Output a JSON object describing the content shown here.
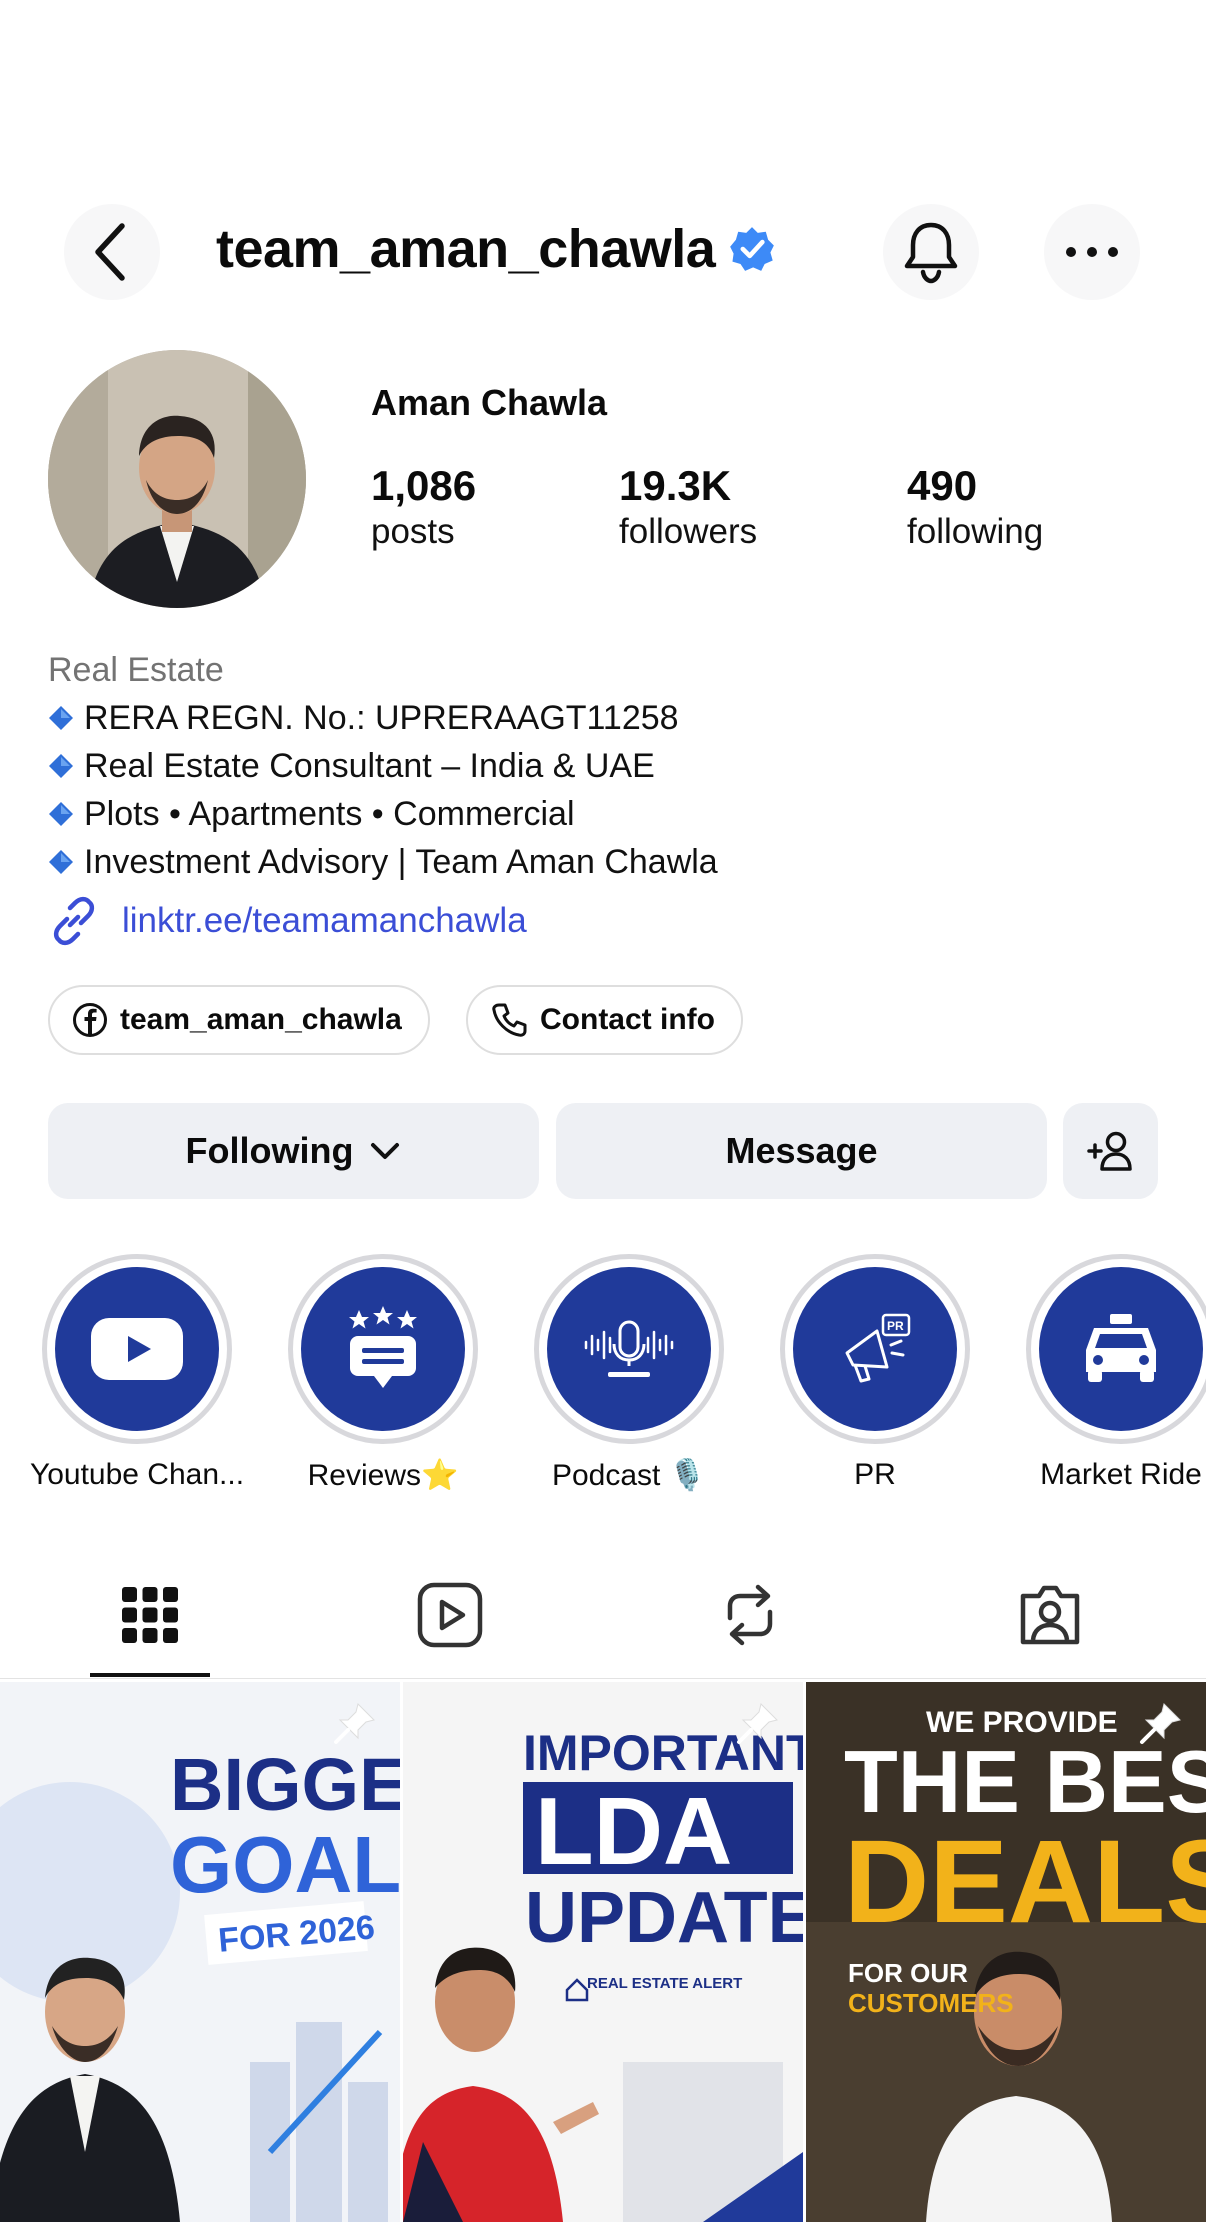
{
  "header": {
    "username": "team_aman_chawla",
    "back_icon": "chevron-left-icon",
    "bell_icon": "bell-icon",
    "more_icon": "more-horizontal-icon"
  },
  "profile": {
    "name": "Aman Chawla",
    "stats": [
      {
        "value": "1,086",
        "label": "posts"
      },
      {
        "value": "19.3K",
        "label": "followers"
      },
      {
        "value": "490",
        "label": "following"
      }
    ],
    "category": "Real Estate",
    "bio_lines": [
      "RERA REGN. No.: UPRERAAGT11258",
      "Real Estate Consultant – India & UAE",
      "Plots • Apartments • Commercial",
      "Investment Advisory | Team Aman Chawla"
    ],
    "link": "linktr.ee/teamamanchawla"
  },
  "chips": {
    "facebook": "team_aman_chawla",
    "contact": "Contact info"
  },
  "actions": {
    "following": "Following",
    "message": "Message"
  },
  "highlights": [
    {
      "label": "Youtube Chan...",
      "icon": "youtube-icon"
    },
    {
      "label": "Reviews⭐",
      "icon": "reviews-icon"
    },
    {
      "label": "Podcast 🎙️",
      "icon": "podcast-icon"
    },
    {
      "label": "PR",
      "icon": "megaphone-icon"
    },
    {
      "label": "Market Ride",
      "icon": "car-icon"
    }
  ],
  "posts": [
    {
      "line1": "BIGGER",
      "line2": "GOALS",
      "line3": "FOR 2026"
    },
    {
      "line1": "IMPORTANT",
      "line2": "LDA",
      "line3": "UPDATE",
      "tag": "REAL ESTATE ALERT"
    },
    {
      "line1": "WE PROVIDE",
      "line2": "THE BEST",
      "line3": "DEALS",
      "line4": "FOR OUR",
      "line5": "CUSTOMERS"
    }
  ],
  "colors": {
    "accent_blue": "#203a9a",
    "link": "#3b4ed6",
    "verified": "#3d8af7",
    "button_bg": "#eef0f4"
  }
}
